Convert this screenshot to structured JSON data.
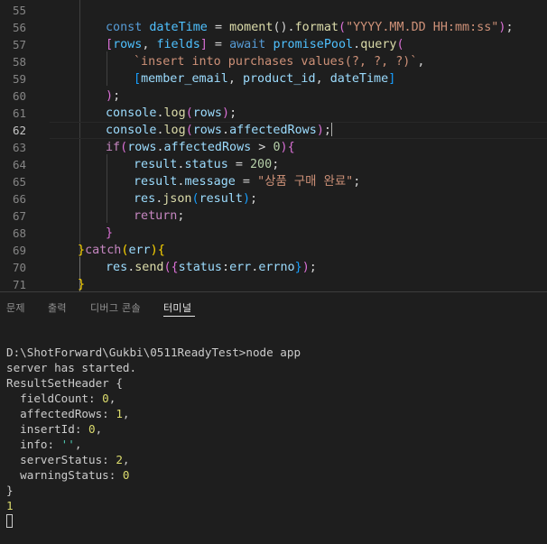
{
  "editor": {
    "active_line": "62",
    "lines": [
      {
        "num": "55"
      },
      {
        "num": "56",
        "t": [
          "const",
          "dateTime",
          "=",
          "moment",
          "().",
          "format",
          "(",
          "\"YYYY.MM.DD HH:mm:ss\"",
          ");"
        ]
      },
      {
        "num": "57",
        "t": [
          "[",
          "rows",
          ", ",
          "fields",
          "] = ",
          "await",
          "promisePool",
          ".",
          "query",
          "("
        ]
      },
      {
        "num": "58",
        "t": [
          "`insert into purchases values(?, ?, ?)`",
          ","
        ]
      },
      {
        "num": "59",
        "t": [
          "[",
          "member_email",
          ", ",
          "product_id",
          ", ",
          "dateTime",
          "]"
        ]
      },
      {
        "num": "60",
        "t": [
          ")",
          ";"
        ]
      },
      {
        "num": "61",
        "t": [
          "console",
          ".",
          "log",
          "(",
          "rows",
          ");"
        ]
      },
      {
        "num": "62",
        "t": [
          "console",
          ".",
          "log",
          "(",
          "rows",
          ".",
          "affectedRows",
          ");"
        ]
      },
      {
        "num": "63",
        "t": [
          "if",
          "(",
          "rows",
          ".",
          "affectedRows",
          " > ",
          "0",
          "){"
        ]
      },
      {
        "num": "64",
        "t": [
          "result",
          ".",
          "status",
          " = ",
          "200",
          ";"
        ]
      },
      {
        "num": "65",
        "t": [
          "result",
          ".",
          "message",
          " = ",
          "\"상품 구매 완료\"",
          ";"
        ]
      },
      {
        "num": "66",
        "t": [
          "res",
          ".",
          "json",
          "(",
          "result",
          ");"
        ]
      },
      {
        "num": "67",
        "t": [
          "return",
          ";"
        ]
      },
      {
        "num": "68",
        "t": [
          "}"
        ]
      },
      {
        "num": "69",
        "t": [
          "}",
          "catch",
          "(",
          "err",
          "){"
        ]
      },
      {
        "num": "70",
        "t": [
          "res",
          ".",
          "send",
          "({",
          "status",
          ":",
          "err",
          ".",
          "errno",
          "});"
        ]
      },
      {
        "num": "71",
        "t": [
          "}"
        ]
      }
    ]
  },
  "panel": {
    "tabs": [
      "문제",
      "출력",
      "디버그 콘솔",
      "터미널"
    ],
    "active_tab": "터미널"
  },
  "terminal": {
    "prompt_line": "D:\\ShotForward\\Gukbi\\0511ReadyTest>node app",
    "line2": "server has started.",
    "header": "ResultSetHeader {",
    "fields": [
      {
        "key": "fieldCount: ",
        "val": "0",
        "sep": ","
      },
      {
        "key": "affectedRows: ",
        "val": "1",
        "sep": ","
      },
      {
        "key": "insertId: ",
        "val": "0",
        "sep": ","
      },
      {
        "key": "info: ",
        "val": "''",
        "sep": ","
      },
      {
        "key": "serverStatus: ",
        "val": "2",
        "sep": ","
      },
      {
        "key": "warningStatus: ",
        "val": "0",
        "sep": ""
      }
    ],
    "close": "}",
    "output": "1"
  },
  "colors": {
    "background": "#1e1e1e",
    "keyword": "#569cd6",
    "string": "#ce9178",
    "number": "#b5cea8",
    "function": "#dcdcaa",
    "variable": "#9cdcfe"
  }
}
